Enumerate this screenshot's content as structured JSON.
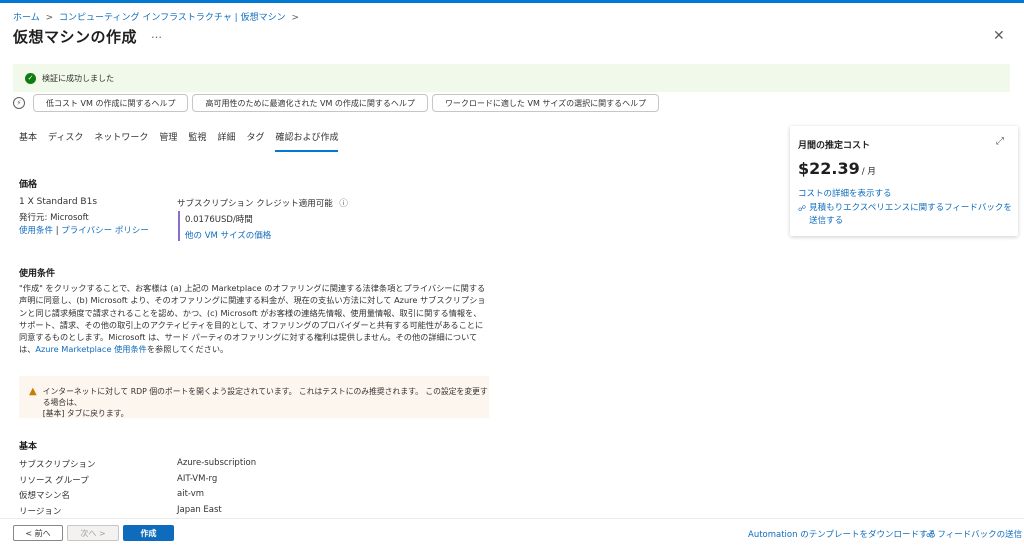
{
  "breadcrumb": {
    "home": "ホーム",
    "parent": "コンピューティング インフラストラクチャ | 仮想マシン",
    "separator": ">"
  },
  "header": {
    "title": "仮想マシンの作成",
    "more": "…",
    "close": "✕"
  },
  "notification": {
    "text": "検証に成功しました",
    "icon": "check-circle-icon",
    "color": "#107c10"
  },
  "help_links": [
    "低コスト VM の作成に関するヘルプ",
    "高可用性のために最適化された VM の作成に関するヘルプ",
    "ワークロードに適した VM サイズの選択に関するヘルプ"
  ],
  "tabs": [
    "基本",
    "ディスク",
    "ネットワーク",
    "管理",
    "監視",
    "詳細",
    "タグ",
    "確認および作成"
  ],
  "active_tab": "確認および作成",
  "price": {
    "heading": "価格",
    "sku": "1 X Standard B1s",
    "publisher": "発行元: Microsoft",
    "terms_link": "使用条件",
    "separator": "|",
    "privacy_link": "プライバシー ポリシー",
    "credit_label": "サブスクリプション クレジット適用可能",
    "rate": "0.0176USD/時間",
    "other_sizes_link": "他の VM サイズの価格"
  },
  "terms": {
    "heading": "使用条件",
    "body": "\"作成\" をクリックすることで、お客様は (a) 上記の Marketplace のオファリングに関連する法律条項とプライバシーに関する声明に同意し、(b) Microsoft より、そのオファリングに関連する料金が、現在の支払い方法に対して Azure サブスクリプションと同じ請求頻度で請求されることを認め、かつ、(c) Microsoft がお客様の連絡先情報、使用量情報、取引に関する情報を、サポート、請求、その他の取引上のアクティビティを目的として、オファリングのプロバイダーと共有する可能性があることに同意するものとします。Microsoft は、サード パーティのオファリングに対する権利は提供しません。その他の詳細については、",
    "link": "Azure Marketplace 使用条件",
    "suffix": "を参照してください。"
  },
  "warning": {
    "line1": "インターネットに対して RDP 個のポートを開くよう設定されています。 これはテストにのみ推奨されます。 この設定を変更する場合は、",
    "line2": "[基本] タブに戻ります。",
    "icon": "warning-icon",
    "color": "#c87c06"
  },
  "basics": {
    "heading": "基本",
    "rows": [
      {
        "label": "サブスクリプション",
        "value": "Azure-subscription"
      },
      {
        "label": "リソース グループ",
        "value": "AIT-VM-rg"
      },
      {
        "label": "仮想マシン名",
        "value": "ait-vm"
      },
      {
        "label": "リージョン",
        "value": "Japan East"
      }
    ]
  },
  "cost_card": {
    "title": "月間の推定コスト",
    "amount": "$22.39",
    "unit": "/ 月",
    "details_link": "コストの詳細を表示する",
    "feedback_link": "見積もりエクスペリエンスに関するフィードバックを送信する"
  },
  "footer": {
    "prev": "< 前へ",
    "next": "次へ >",
    "create": "作成",
    "download_link": "Automation のテンプレートをダウンロードする",
    "feedback_link": "フィードバックの送信"
  },
  "colors": {
    "accent": "#0f6cbd",
    "success_bg": "#f1f9ea",
    "warning_bg": "#fdf6ef"
  }
}
